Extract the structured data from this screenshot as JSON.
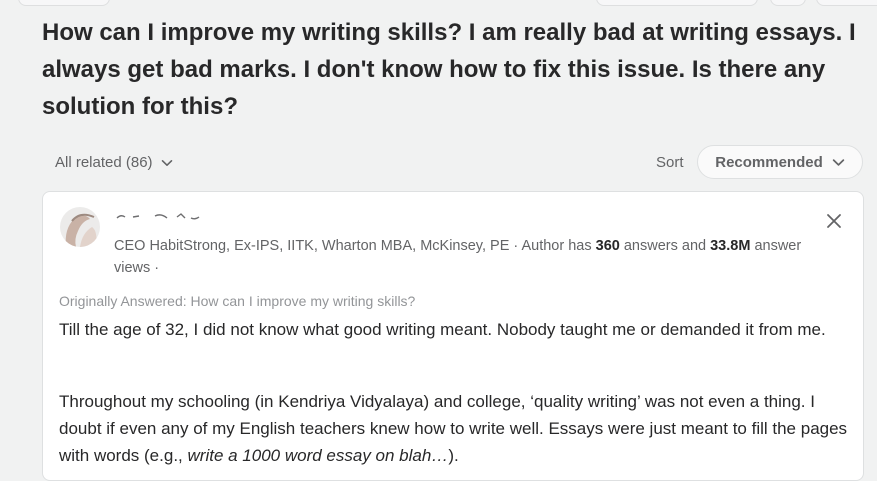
{
  "question": {
    "title": "How can I improve my writing skills? I am really bad at writing essays. I always get bad marks. I don't know how to fix this issue. Is there any solution for this?"
  },
  "filter": {
    "all_related_label": "All related (86)",
    "chevron_icon": "chevron-down-icon"
  },
  "sort": {
    "label": "Sort",
    "selected": "Recommended"
  },
  "answer": {
    "author_name": "",
    "credentials_prefix": "CEO HabitStrong, Ex-IPS, IITK, Wharton MBA, McKinsey, PE · Author has ",
    "answers_count": "360",
    "credentials_mid": " answers and ",
    "views_count": "33.8M",
    "credentials_suffix": " answer views ·",
    "originally_answered": "Originally Answered: How can I improve my writing skills?",
    "paragraph1": "Till the age of 32, I did not know what good writing meant. Nobody taught me or demanded it from me.",
    "paragraph2_text": "Throughout my schooling (in Kendriya Vidyalaya) and college, ‘quality writing’ was not even a thing. I doubt if even any of my English teachers knew how to write well. Essays were just meant to fill the pages with words (e.g., ",
    "paragraph2_italic": "write a 1000 word essay on blah…",
    "paragraph2_end": ").",
    "close_icon": "close-icon"
  },
  "colors": {
    "background": "#f1f2f2",
    "card": "#ffffff",
    "text_primary": "#282829",
    "text_secondary": "#636466",
    "text_muted": "#939598",
    "border": "#dee0e1"
  }
}
